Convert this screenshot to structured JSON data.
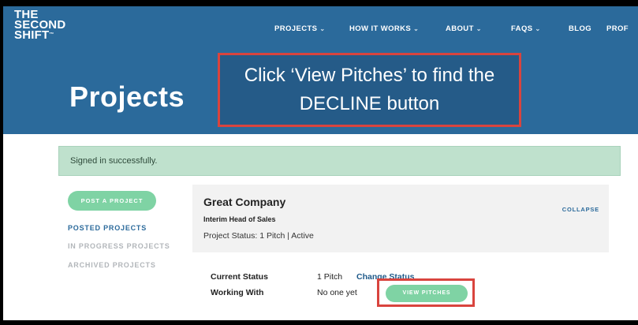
{
  "brand": {
    "logo_lines": [
      "THE",
      "SECOND",
      "SHIFT"
    ],
    "logo_mark": "™"
  },
  "nav": {
    "items": [
      {
        "label": "PROJECTS",
        "has_dropdown": true
      },
      {
        "label": "HOW IT WORKS",
        "has_dropdown": true
      },
      {
        "label": "ABOUT",
        "has_dropdown": true
      },
      {
        "label": "FAQS",
        "has_dropdown": true
      },
      {
        "label": "BLOG",
        "has_dropdown": false
      },
      {
        "label": "PROF",
        "has_dropdown": false
      }
    ],
    "dropdown_glyph": "⌄"
  },
  "page": {
    "title": "Projects"
  },
  "callout": {
    "line1": "Click ‘View Pitches’ to find the",
    "line2": "DECLINE button",
    "border_color": "#d9443e"
  },
  "flash": {
    "message": "Signed in successfully."
  },
  "sidebar": {
    "post_button": "POST A PROJECT",
    "links": [
      {
        "label": "POSTED PROJECTS",
        "active": true
      },
      {
        "label": "IN PROGRESS PROJECTS",
        "active": false
      },
      {
        "label": "ARCHIVED PROJECTS",
        "active": false
      }
    ]
  },
  "project": {
    "company": "Great Company",
    "role": "Interim Head of Sales",
    "status_line": "Project Status: 1 Pitch | Active",
    "collapse_label": "COLLAPSE"
  },
  "details": {
    "current_status_label": "Current Status",
    "current_status_value": "1 Pitch",
    "change_status_link": "Change Status",
    "working_with_label": "Working With",
    "working_with_value": "No one yet",
    "view_pitches_button": "VIEW PITCHES"
  },
  "colors": {
    "header_blue": "#2b6a9b",
    "accent_green": "#7fd3a4",
    "flash_green": "#bfe1cd",
    "highlight_red": "#d9443e"
  }
}
